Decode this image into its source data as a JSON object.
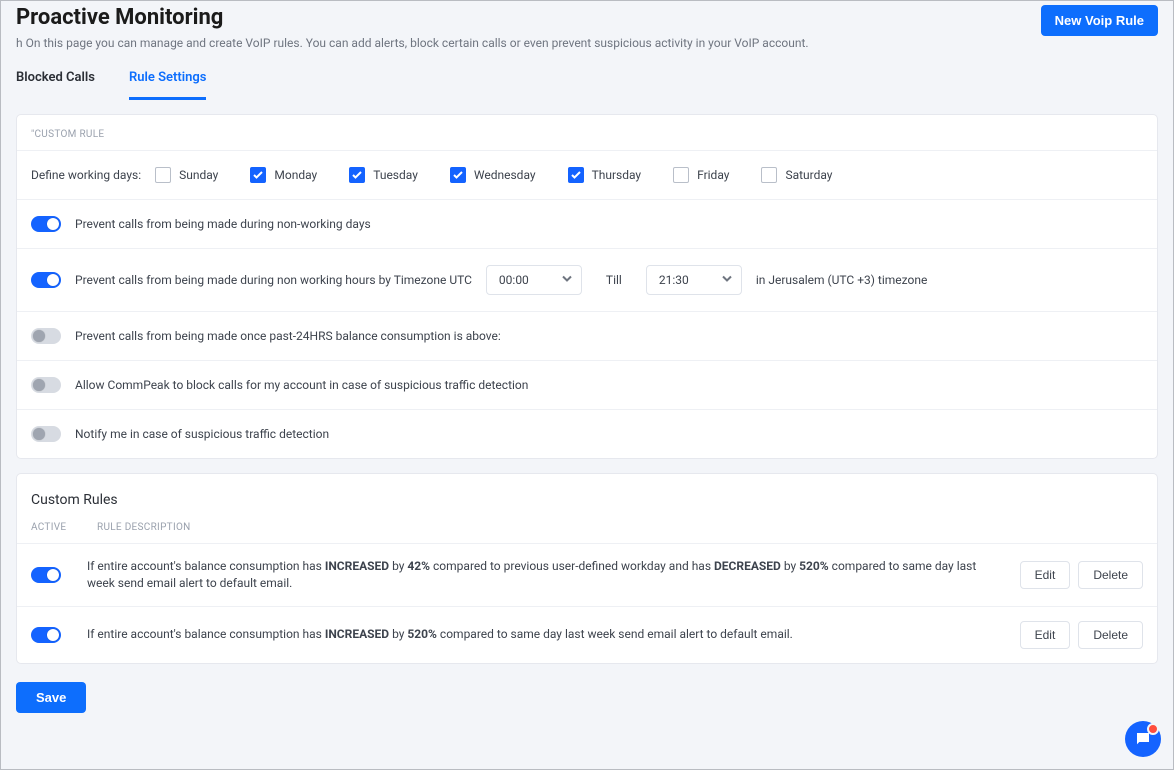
{
  "header": {
    "title": "Proactive Monitoring",
    "new_btn": "New Voip Rule",
    "desc_prefix": "h",
    "description": "On this page you can manage and create VoIP rules. You can add alerts, block certain calls or even prevent suspicious activity in your VoIP account."
  },
  "tabs": {
    "blocked_calls": "Blocked Calls",
    "rule_settings": "Rule Settings"
  },
  "custom_rule": {
    "section_label": "\"Custom Rule",
    "define_label": "Define working days:",
    "days": {
      "sunday": {
        "label": "Sunday",
        "checked": false
      },
      "monday": {
        "label": "Monday",
        "checked": true
      },
      "tuesday": {
        "label": "Tuesday",
        "checked": true
      },
      "wednesday": {
        "label": "Wednesday",
        "checked": true
      },
      "thursday": {
        "label": "Thursday",
        "checked": true
      },
      "friday": {
        "label": "Friday",
        "checked": false
      },
      "saturday": {
        "label": "Saturday",
        "checked": false
      }
    },
    "toggles": {
      "nonworking_days": {
        "on": true,
        "label": "Prevent calls from being made during non-working days"
      },
      "nonworking_hours": {
        "on": true,
        "label": "Prevent calls from being made during non working hours by Timezone UTC",
        "from": "00:00",
        "till_label": "Till",
        "to": "21:30",
        "tz_note": "in Jerusalem (UTC +3) timezone"
      },
      "balance": {
        "on": false,
        "label": "Prevent calls from being made once past-24HRS balance consumption is above:"
      },
      "block_susp": {
        "on": false,
        "label": "Allow CommPeak to block calls for my account in case of suspicious traffic detection"
      },
      "notify_susp": {
        "on": false,
        "label": "Notify me in case of suspicious traffic detection"
      }
    }
  },
  "rules_section": {
    "title": "Custom Rules",
    "col_active": "ACTIVE",
    "col_desc": "RULE DESCRIPTION",
    "edit": "Edit",
    "delete": "Delete",
    "rules": [
      {
        "on": true,
        "pre1": "If entire account's balance consumption has ",
        "s1": "INCREASED",
        "mid1": " by ",
        "v1": "42%",
        "mid2": " compared to previous user-defined workday and has ",
        "s2": "DECREASED",
        "mid3": " by ",
        "v2": "520%",
        "post": " compared to same day last week send email alert to default email."
      },
      {
        "on": true,
        "pre1": "If entire account's balance consumption has ",
        "s1": "INCREASED",
        "mid1": " by ",
        "v1": "520%",
        "mid2": "",
        "s2": "",
        "mid3": "",
        "v2": "",
        "post": " compared to same day last week send email alert to default email."
      }
    ]
  },
  "footer": {
    "save": "Save"
  }
}
